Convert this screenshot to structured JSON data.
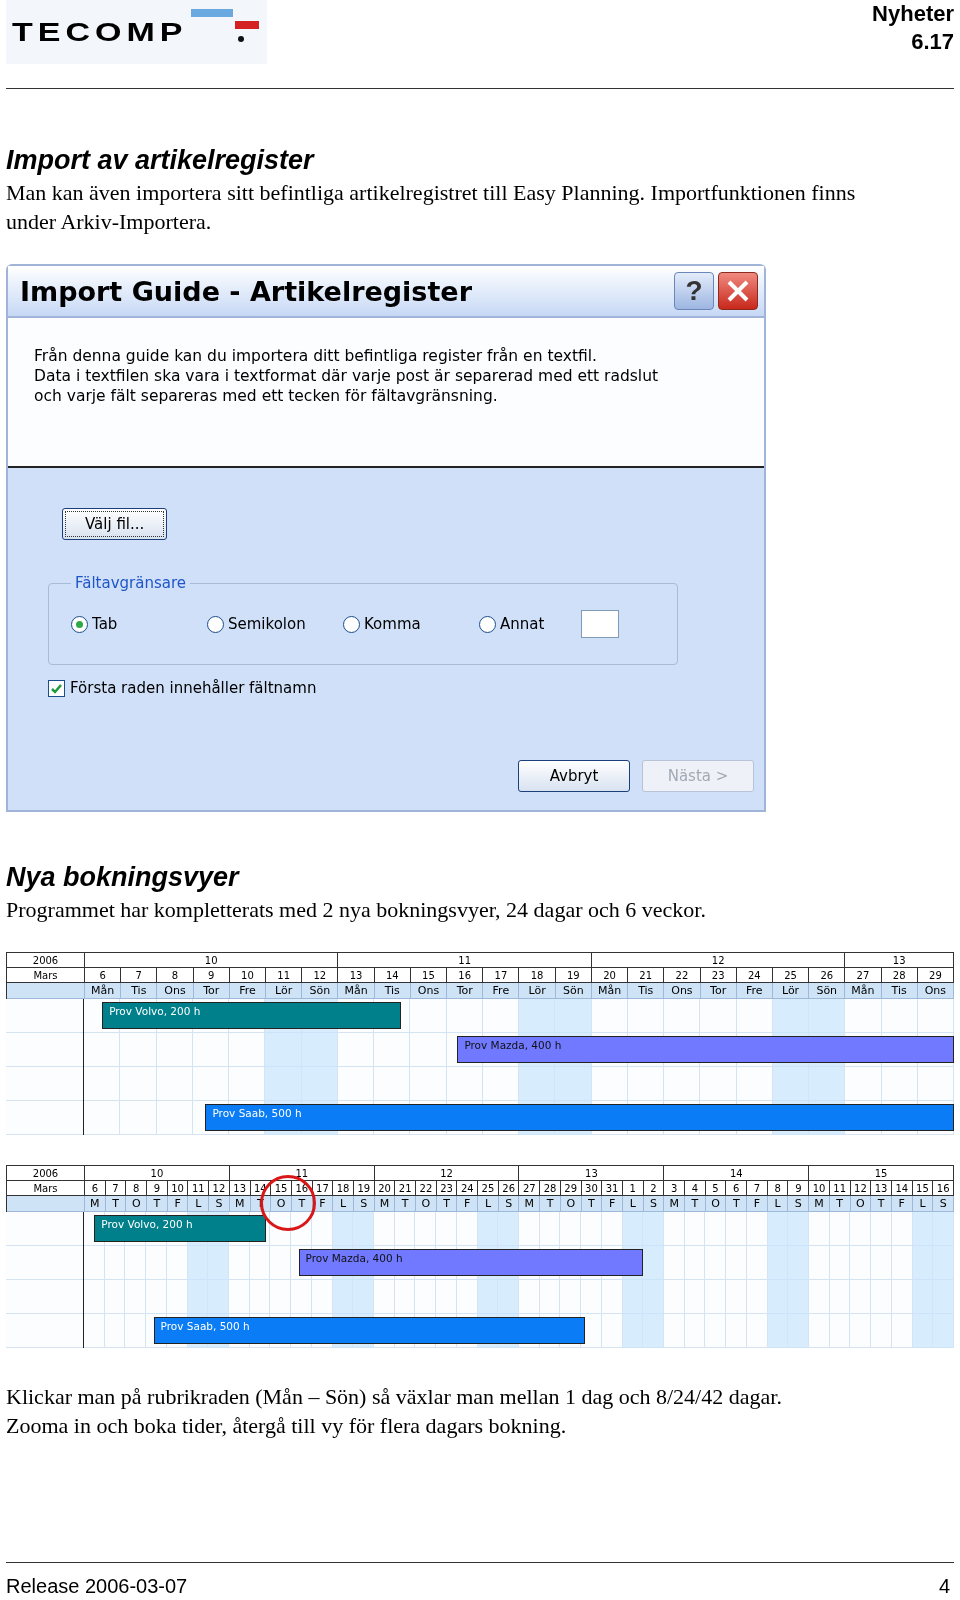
{
  "header": {
    "logo": "TECOMP",
    "title": "Nyheter",
    "version": "6.17"
  },
  "section_1": {
    "heading": "Import av artikelregister",
    "paragraph": "Man kan även importera sitt befintliga artikelregistret till Easy Planning. Importfunktionen finns under Arkiv-Importera."
  },
  "dialog": {
    "title": "Import Guide - Artikelregister",
    "help_button": "?",
    "intro_lines": [
      "Från denna guide kan du importera ditt befintliga register från en textfil.",
      "Data i textfilen ska vara i textformat där varje post är separerad med ett radslut",
      "och varje fält separeras med ett tecken för fältavgränsning."
    ],
    "choose_file_button": "Välj fil...",
    "delimiter_group": {
      "label": "Fältavgränsare",
      "options": [
        {
          "label": "Tab",
          "selected": true
        },
        {
          "label": "Semikolon",
          "selected": false
        },
        {
          "label": "Komma",
          "selected": false
        },
        {
          "label": "Annat",
          "selected": false
        }
      ]
    },
    "header_checkbox": {
      "label": "Första raden innehåller fältnamn",
      "checked": true
    },
    "buttons": [
      {
        "label": "Avbryt",
        "disabled": false
      },
      {
        "label": "Nästa >",
        "disabled": true
      }
    ]
  },
  "section_2": {
    "heading": "Nya bokningsvyer",
    "paragraph": "Programmet har kompletterats med 2 nya bokningsvyer, 24 dagar och 6 veckor."
  },
  "booking_views": [
    {
      "year": "2006",
      "month": "Mars",
      "circled": false,
      "weeks": [
        {
          "label": "10",
          "days": [
            {
              "date": "6",
              "weekday": "Mån",
              "weekend": false
            },
            {
              "date": "7",
              "weekday": "Tis",
              "weekend": false
            },
            {
              "date": "8",
              "weekday": "Ons",
              "weekend": false
            },
            {
              "date": "9",
              "weekday": "Tor",
              "weekend": false
            },
            {
              "date": "10",
              "weekday": "Fre",
              "weekend": false
            },
            {
              "date": "11",
              "weekday": "Lör",
              "weekend": true
            },
            {
              "date": "12",
              "weekday": "Sön",
              "weekend": true
            }
          ]
        },
        {
          "label": "11",
          "days": [
            {
              "date": "13",
              "weekday": "Mån",
              "weekend": false
            },
            {
              "date": "14",
              "weekday": "Tis",
              "weekend": false
            },
            {
              "date": "15",
              "weekday": "Ons",
              "weekend": false
            },
            {
              "date": "16",
              "weekday": "Tor",
              "weekend": false
            },
            {
              "date": "17",
              "weekday": "Fre",
              "weekend": false
            },
            {
              "date": "18",
              "weekday": "Lör",
              "weekend": true
            },
            {
              "date": "19",
              "weekday": "Sön",
              "weekend": true
            }
          ]
        },
        {
          "label": "12",
          "days": [
            {
              "date": "20",
              "weekday": "Mån",
              "weekend": false
            },
            {
              "date": "21",
              "weekday": "Tis",
              "weekend": false
            },
            {
              "date": "22",
              "weekday": "Ons",
              "weekend": false
            },
            {
              "date": "23",
              "weekday": "Tor",
              "weekend": false
            },
            {
              "date": "24",
              "weekday": "Fre",
              "weekend": false
            },
            {
              "date": "25",
              "weekday": "Lör",
              "weekend": true
            },
            {
              "date": "26",
              "weekday": "Sön",
              "weekend": true
            }
          ]
        },
        {
          "label": "13",
          "days": [
            {
              "date": "27",
              "weekday": "Mån",
              "weekend": false
            },
            {
              "date": "28",
              "weekday": "Tis",
              "weekend": false
            },
            {
              "date": "29",
              "weekday": "Ons",
              "weekend": false
            }
          ]
        }
      ],
      "bars": [
        {
          "label": "Prov Volvo, 200 h",
          "color": "#00808a"
        },
        {
          "label": "Prov Mazda, 400 h",
          "color": "#7079ff"
        },
        {
          "label": "Prov Saab, 500 h",
          "color": "#0a7cf5"
        }
      ]
    },
    {
      "year": "2006",
      "month": "Mars",
      "circled": true,
      "weeks": [
        {
          "label": "10",
          "days": [
            {
              "date": "6",
              "weekday": "M",
              "weekend": false
            },
            {
              "date": "7",
              "weekday": "T",
              "weekend": false
            },
            {
              "date": "8",
              "weekday": "O",
              "weekend": false
            },
            {
              "date": "9",
              "weekday": "T",
              "weekend": false
            },
            {
              "date": "10",
              "weekday": "F",
              "weekend": false
            },
            {
              "date": "11",
              "weekday": "L",
              "weekend": true
            },
            {
              "date": "12",
              "weekday": "S",
              "weekend": true
            }
          ]
        },
        {
          "label": "11",
          "days": [
            {
              "date": "13",
              "weekday": "M",
              "weekend": false
            },
            {
              "date": "14",
              "weekday": "T",
              "weekend": false
            },
            {
              "date": "15",
              "weekday": "O",
              "weekend": false
            },
            {
              "date": "16",
              "weekday": "T",
              "weekend": false
            },
            {
              "date": "17",
              "weekday": "F",
              "weekend": false
            },
            {
              "date": "18",
              "weekday": "L",
              "weekend": true
            },
            {
              "date": "19",
              "weekday": "S",
              "weekend": true
            }
          ]
        },
        {
          "label": "12",
          "days": [
            {
              "date": "20",
              "weekday": "M",
              "weekend": false
            },
            {
              "date": "21",
              "weekday": "T",
              "weekend": false
            },
            {
              "date": "22",
              "weekday": "O",
              "weekend": false
            },
            {
              "date": "23",
              "weekday": "T",
              "weekend": false
            },
            {
              "date": "24",
              "weekday": "F",
              "weekend": false
            },
            {
              "date": "25",
              "weekday": "L",
              "weekend": true
            },
            {
              "date": "26",
              "weekday": "S",
              "weekend": true
            }
          ]
        },
        {
          "label": "13",
          "days": [
            {
              "date": "27",
              "weekday": "M",
              "weekend": false
            },
            {
              "date": "28",
              "weekday": "T",
              "weekend": false
            },
            {
              "date": "29",
              "weekday": "O",
              "weekend": false
            },
            {
              "date": "30",
              "weekday": "T",
              "weekend": false
            },
            {
              "date": "31",
              "weekday": "F",
              "weekend": false
            },
            {
              "date": "1",
              "weekday": "L",
              "weekend": true
            },
            {
              "date": "2",
              "weekday": "S",
              "weekend": true
            }
          ]
        },
        {
          "label": "14",
          "days": [
            {
              "date": "3",
              "weekday": "M",
              "weekend": false
            },
            {
              "date": "4",
              "weekday": "T",
              "weekend": false
            },
            {
              "date": "5",
              "weekday": "O",
              "weekend": false
            },
            {
              "date": "6",
              "weekday": "T",
              "weekend": false
            },
            {
              "date": "7",
              "weekday": "F",
              "weekend": false
            },
            {
              "date": "8",
              "weekday": "L",
              "weekend": true
            },
            {
              "date": "9",
              "weekday": "S",
              "weekend": true
            }
          ]
        },
        {
          "label": "15",
          "days": [
            {
              "date": "10",
              "weekday": "M",
              "weekend": false
            },
            {
              "date": "11",
              "weekday": "T",
              "weekend": false
            },
            {
              "date": "12",
              "weekday": "O",
              "weekend": false
            },
            {
              "date": "13",
              "weekday": "T",
              "weekend": false
            },
            {
              "date": "14",
              "weekday": "F",
              "weekend": false
            },
            {
              "date": "15",
              "weekday": "L",
              "weekend": true
            },
            {
              "date": "16",
              "weekday": "S",
              "weekend": true
            }
          ]
        }
      ],
      "bars": [
        {
          "label": "Prov Volvo, 200 h",
          "color": "#00808a"
        },
        {
          "label": "Prov Mazda, 400 h",
          "color": "#7079ff"
        },
        {
          "label": "Prov Saab, 500 h",
          "color": "#0a7cf5"
        }
      ]
    }
  ],
  "closing_lines": [
    "Klickar man på rubrikraden (Mån – Sön) så växlar man mellan 1 dag och 8/24/42 dagar.",
    "Zooma in och boka tider, återgå till vy för flera dagars bokning."
  ],
  "footer": {
    "release": "Release 2006-03-07",
    "page": "4"
  }
}
